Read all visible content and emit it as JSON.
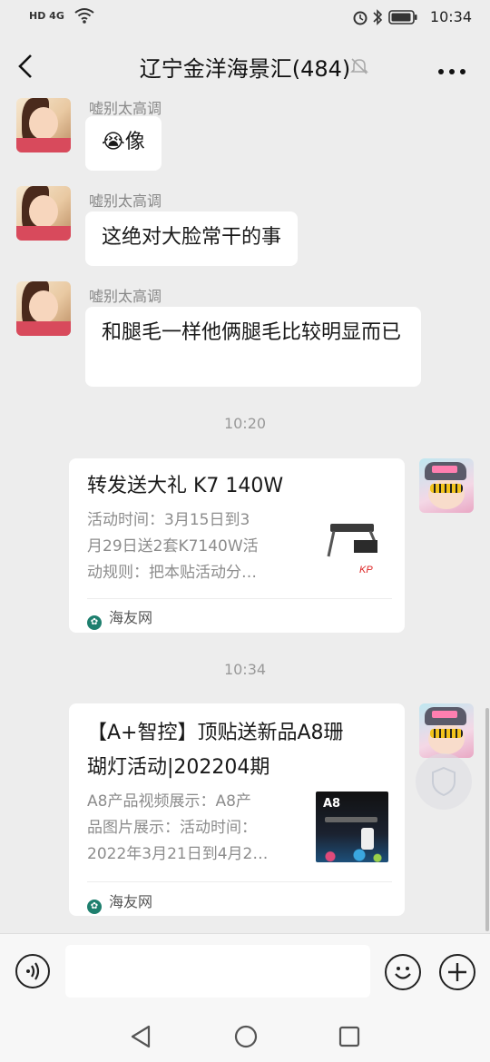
{
  "status_bar": {
    "time": "10:34",
    "signal_label": "HD 4G"
  },
  "header": {
    "title": "辽宁金洋海景汇(484)"
  },
  "messages": [
    {
      "sender": "嘘别太高调",
      "text": "😭像"
    },
    {
      "sender": "嘘别太高调",
      "text": "这绝对大脸常干的事"
    },
    {
      "sender": "嘘别太高调",
      "text": "和腿毛一样他俩腿毛比较明显而已"
    }
  ],
  "time_1": "10:20",
  "card_1": {
    "title": "转发送大礼  K7 140W",
    "desc": [
      "活动时间：3月15日到3",
      "月29日送2套K7140W活",
      "动规则：把本贴活动分…"
    ],
    "source": "海友网"
  },
  "time_2": "10:34",
  "card_2": {
    "title": [
      "【A+智控】顶贴送新品A8珊",
      "瑚灯活动|202204期"
    ],
    "desc": [
      "A8产品视频展示：A8产",
      "品图片展示：活动时间：",
      "2022年3月21日到4月2…"
    ],
    "thumb_label": "A8",
    "source": "海友网"
  },
  "colors": {
    "background": "#ededed",
    "bubble": "#ffffff",
    "accent": "#1e7f6e"
  }
}
